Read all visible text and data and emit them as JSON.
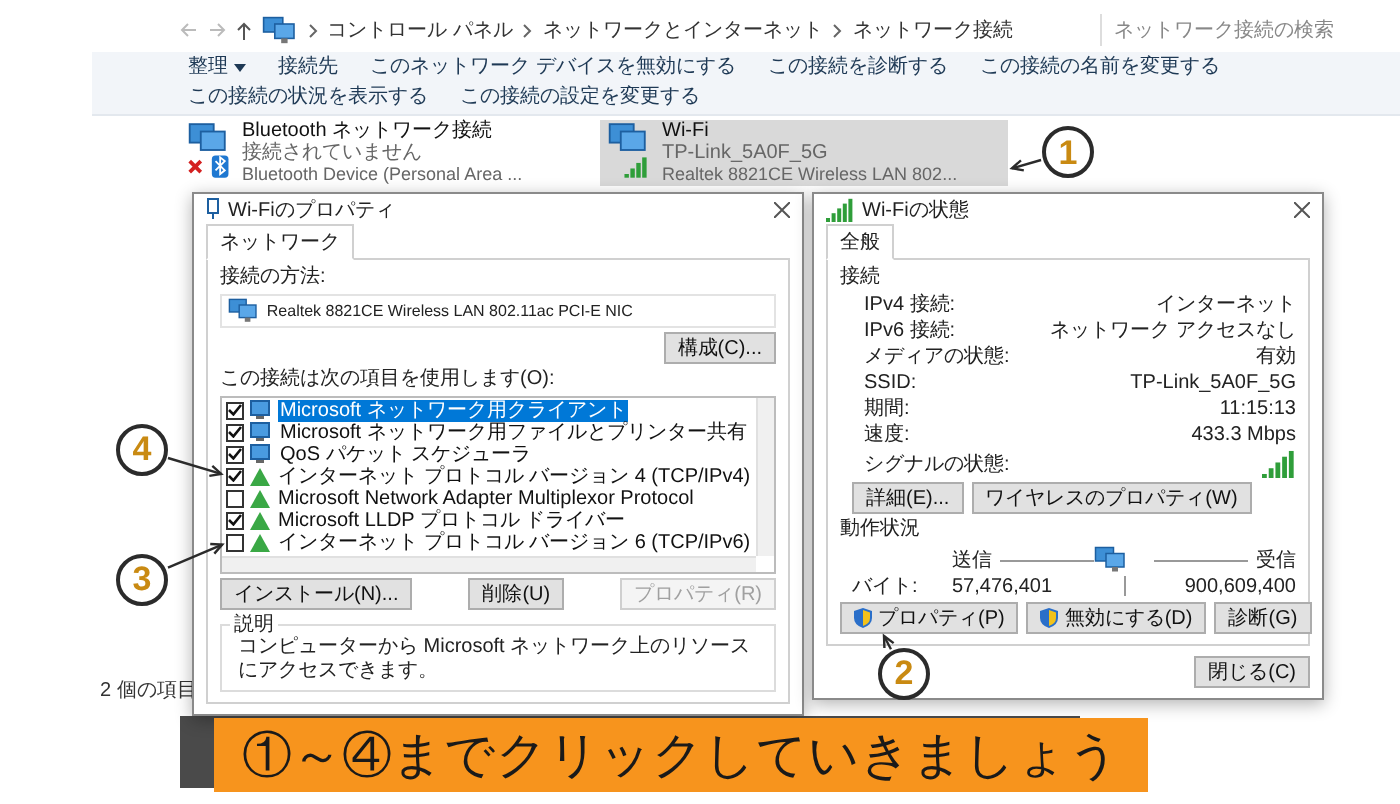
{
  "explorer": {
    "breadcrumb": [
      "コントロール パネル",
      "ネットワークとインターネット",
      "ネットワーク接続"
    ],
    "search": {
      "placeholder": "ネットワーク接続の検索"
    },
    "toolbar": [
      {
        "label": "整理",
        "kind": "menu"
      },
      {
        "label": "接続先",
        "kind": "command"
      },
      {
        "label": "このネットワーク デバイスを無効にする",
        "kind": "command"
      },
      {
        "label": "この接続を診断する",
        "kind": "command"
      },
      {
        "label": "この接続の名前を変更する",
        "kind": "command"
      },
      {
        "label": "この接続の状況を表示する",
        "kind": "command"
      },
      {
        "label": "この接続の設定を変更する",
        "kind": "command"
      }
    ],
    "connections": [
      {
        "name": "Bluetooth ネットワーク接続",
        "status": "接続されていません",
        "device": "Bluetooth Device (Personal Area ...",
        "kind": "bluetooth",
        "selected": false
      },
      {
        "name": "Wi-Fi",
        "status": "TP-Link_5A0F_5G",
        "device": "Realtek 8821CE Wireless LAN 802...",
        "kind": "wifi",
        "selected": true,
        "annotation": "1"
      }
    ],
    "status_bar": "2 個の項目"
  },
  "properties_dialog": {
    "title": "Wi-Fiのプロパティ",
    "tabs": [
      {
        "label": "ネットワーク",
        "selected": true
      }
    ],
    "connect_using_label": "接続の方法:",
    "adapter": "Realtek 8821CE Wireless LAN 802.11ac PCI-E NIC",
    "configure_button": "構成(C)...",
    "items_label": "この接続は次の項目を使用します(O):",
    "items": [
      {
        "label": "Microsoft ネットワーク用クライアント",
        "kind": "client",
        "checked": true,
        "selected": true
      },
      {
        "label": "Microsoft ネットワーク用ファイルとプリンター共有",
        "kind": "service",
        "checked": true,
        "selected": false
      },
      {
        "label": "QoS パケット スケジューラ",
        "kind": "service",
        "checked": true,
        "selected": false
      },
      {
        "label": "インターネット プロトコル バージョン 4 (TCP/IPv4)",
        "kind": "protocol",
        "checked": true,
        "selected": false,
        "annotation": "4"
      },
      {
        "label": "Microsoft Network Adapter Multiplexor Protocol",
        "kind": "protocol",
        "checked": false,
        "selected": false
      },
      {
        "label": "Microsoft LLDP プロトコル ドライバー",
        "kind": "protocol",
        "checked": true,
        "selected": false
      },
      {
        "label": "インターネット プロトコル バージョン 6 (TCP/IPv6)",
        "kind": "protocol",
        "checked": false,
        "selected": false,
        "annotation": "3"
      }
    ],
    "buttons": [
      {
        "label": "インストール(N)...",
        "disabled": false
      },
      {
        "label": "削除(U)",
        "disabled": false
      },
      {
        "label": "プロパティ(R)",
        "disabled": true
      }
    ],
    "description_label": "説明",
    "description": "コンピューターから Microsoft ネットワーク上のリソースにアクセスできます。"
  },
  "status_dialog": {
    "title": "Wi-Fiの状態",
    "tabs": [
      {
        "label": "全般",
        "selected": true
      }
    ],
    "connection_heading": "接続",
    "fields": [
      {
        "label": "IPv4 接続:",
        "value": "インターネット"
      },
      {
        "label": "IPv6 接続:",
        "value": "ネットワーク アクセスなし"
      },
      {
        "label": "メディアの状態:",
        "value": "有効"
      },
      {
        "label": "SSID:",
        "value": "TP-Link_5A0F_5G"
      },
      {
        "label": "期間:",
        "value": "11:15:13"
      },
      {
        "label": "速度:",
        "value": "433.3 Mbps"
      }
    ],
    "signal_label": "シグナルの状態:",
    "detail_buttons": [
      {
        "label": "詳細(E)..."
      },
      {
        "label": "ワイヤレスのプロパティ(W)"
      }
    ],
    "activity_heading": "動作状況",
    "sent_label": "送信",
    "received_label": "受信",
    "bytes_label": "バイト:",
    "bytes_sent": "57,476,401",
    "bytes_received": "900,609,400",
    "action_buttons": [
      {
        "label": "プロパティ(P)",
        "shield": true,
        "annotation": "2"
      },
      {
        "label": "無効にする(D)",
        "shield": true
      },
      {
        "label": "診断(G)",
        "shield": false
      }
    ],
    "close_button": "閉じる(C)"
  },
  "banner": "①～④までクリックしていきましょう"
}
